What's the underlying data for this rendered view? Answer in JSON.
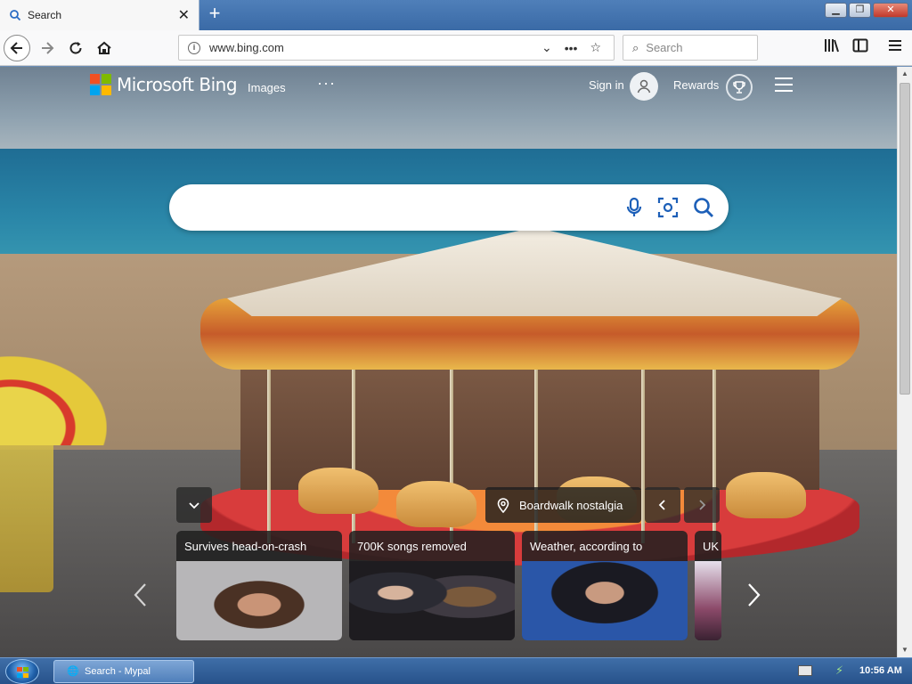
{
  "browser": {
    "tab": {
      "label": "Search",
      "icon": "search-icon",
      "close_glyph": "✕"
    },
    "new_tab_glyph": "+",
    "window_controls": [
      "minimize",
      "maximize",
      "close"
    ],
    "url": "www.bing.com",
    "search_placeholder": "Search",
    "toolbar_icons": [
      "back-icon",
      "forward-icon",
      "reload-icon",
      "home-icon",
      "library-icon",
      "sidebar-icon",
      "menu-icon"
    ]
  },
  "bing": {
    "logo_text": "Microsoft Bing",
    "nav": {
      "images": "Images",
      "more": "···"
    },
    "signin": "Sign in",
    "rewards": "Rewards",
    "search_value": "",
    "image_caption": "Boardwalk nostalgia",
    "news": [
      {
        "title": "Survives head-on-crash"
      },
      {
        "title": "700K songs removed"
      },
      {
        "title": "Weather, according to"
      },
      {
        "title": "UK"
      }
    ]
  },
  "colors": {
    "ms_red": "#f25022",
    "ms_green": "#7fba00",
    "ms_blue": "#00a4ef",
    "ms_yellow": "#ffb900"
  },
  "taskbar": {
    "window_label": "Search - Mypal",
    "clock": "10:56 AM"
  }
}
